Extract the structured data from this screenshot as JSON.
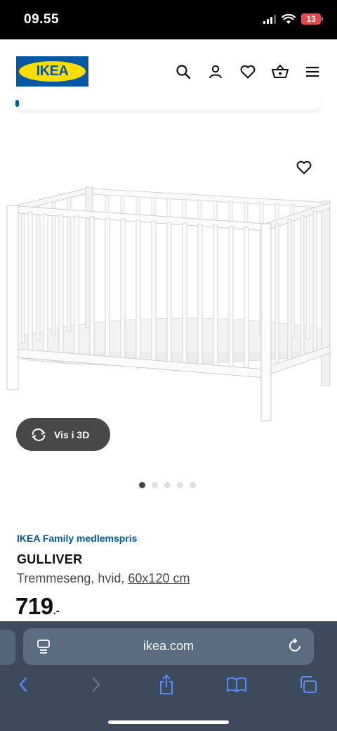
{
  "status": {
    "time": "09.55",
    "battery": "13"
  },
  "header": {
    "logo_text": "IKEA"
  },
  "product": {
    "family_price_label": "IKEA Family medlemspris",
    "name": "GULLIVER",
    "description": "Tremmeseng, hvid,",
    "size": "60x120 cm",
    "price": "719",
    "price_suffix": ".-",
    "view_3d_label": "Vis i 3D",
    "image_count": 5,
    "image_index": 1
  },
  "browser": {
    "url": "ikea.com"
  },
  "colors": {
    "brand_blue": "#0058a3",
    "brand_yellow": "#ffdb00",
    "browser_bg": "#3d4a5c"
  }
}
